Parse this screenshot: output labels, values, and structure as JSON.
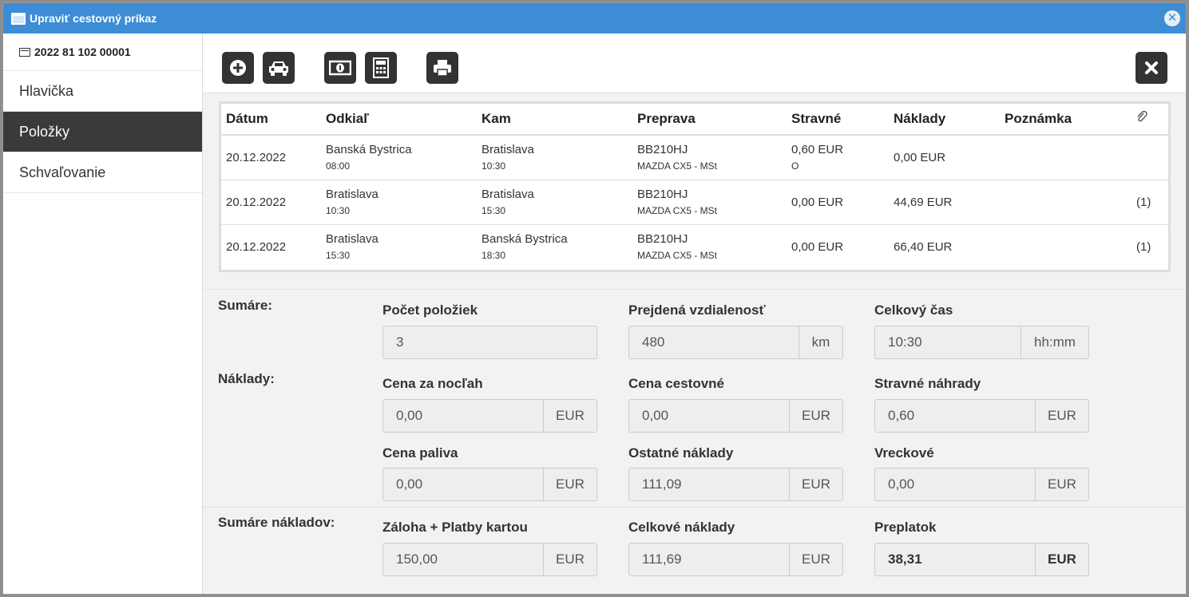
{
  "window": {
    "title": "Upraviť cestovný príkaz"
  },
  "sidebar": {
    "doc_number": "2022 81 102 00001",
    "items": [
      {
        "label": "Hlavička",
        "active": false
      },
      {
        "label": "Položky",
        "active": true
      },
      {
        "label": "Schvaľovanie",
        "active": false
      }
    ]
  },
  "toolbar": {
    "buttons": [
      "plus-circle-icon",
      "car-icon",
      "money-icon",
      "calculator-icon",
      "print-icon",
      "close-icon"
    ]
  },
  "table": {
    "headers": [
      "Dátum",
      "Odkiaľ",
      "Kam",
      "Preprava",
      "Stravné",
      "Náklady",
      "Poznámka"
    ],
    "attachment_header_icon": "paperclip-icon",
    "rows": [
      {
        "date": "20.12.2022",
        "from": "Banská Bystrica",
        "from_time": "08:00",
        "to": "Bratislava",
        "to_time": "10:30",
        "vehicle": "BB210HJ",
        "vehicle_model": "MAZDA CX5 - MSt",
        "meals": "0,60 EUR",
        "meals_note": "O",
        "costs": "0,00 EUR",
        "note": "",
        "attachments": ""
      },
      {
        "date": "20.12.2022",
        "from": "Bratislava",
        "from_time": "10:30",
        "to": "Bratislava",
        "to_time": "15:30",
        "vehicle": "BB210HJ",
        "vehicle_model": "MAZDA CX5 - MSt",
        "meals": "0,00 EUR",
        "meals_note": "",
        "costs": "44,69 EUR",
        "note": "",
        "attachments": "(1)"
      },
      {
        "date": "20.12.2022",
        "from": "Bratislava",
        "from_time": "15:30",
        "to": "Banská Bystrica",
        "to_time": "18:30",
        "vehicle": "BB210HJ",
        "vehicle_model": "MAZDA CX5 - MSt",
        "meals": "0,00 EUR",
        "meals_note": "",
        "costs": "66,40 EUR",
        "note": "",
        "attachments": "(1)"
      }
    ]
  },
  "summaries": {
    "section_label": "Sumáre:",
    "item_count": {
      "label": "Počet položiek",
      "value": "3"
    },
    "distance": {
      "label": "Prejdená vzdialenosť",
      "value": "480",
      "unit": "km"
    },
    "total_time": {
      "label": "Celkový čas",
      "value": "10:30",
      "unit": "hh:mm"
    }
  },
  "costs": {
    "section_label": "Náklady:",
    "night_price": {
      "label": "Cena za nocľah",
      "value": "0,00",
      "unit": "EUR"
    },
    "travel_price": {
      "label": "Cena cestovné",
      "value": "0,00",
      "unit": "EUR"
    },
    "meal_compensation": {
      "label": "Stravné náhrady",
      "value": "0,60",
      "unit": "EUR"
    },
    "fuel_price": {
      "label": "Cena paliva",
      "value": "0,00",
      "unit": "EUR"
    },
    "other_costs": {
      "label": "Ostatné náklady",
      "value": "111,09",
      "unit": "EUR"
    },
    "pocket_money": {
      "label": "Vreckové",
      "value": "0,00",
      "unit": "EUR"
    }
  },
  "cost_summaries": {
    "section_label": "Sumáre nákladov:",
    "advance_card": {
      "label": "Záloha + Platby kartou",
      "value": "150,00",
      "unit": "EUR"
    },
    "total_costs": {
      "label": "Celkové náklady",
      "value": "111,69",
      "unit": "EUR"
    },
    "overpayment": {
      "label": "Preplatok",
      "value": "38,31",
      "unit": "EUR"
    }
  }
}
